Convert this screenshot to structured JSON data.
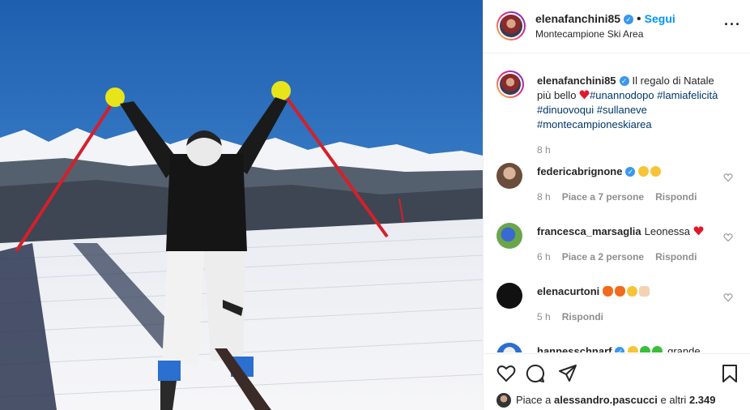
{
  "header": {
    "username": "elenafanchini85",
    "separator": "•",
    "follow_label": "Segui",
    "location": "Montecampione Ski Area",
    "more_icon": "more-icon"
  },
  "caption": {
    "username": "elenafanchini85",
    "text": "Il regalo di Natale più bello",
    "hashtags": [
      "#unannodopo",
      "#lamiafelicità",
      "#dinuovoqui",
      "#sullaneve",
      "#montecampioneskiarea"
    ],
    "time": "8 h"
  },
  "comments": [
    {
      "username": "federicabrignone",
      "emojis": [
        "heart-eyes-emoji",
        "heart-eyes-emoji"
      ],
      "text": "",
      "time": "8 h",
      "likes": "Piace a 7 persone",
      "reply": "Rispondi"
    },
    {
      "username": "francesca_marsaglia",
      "text": "Leonessa",
      "emojis": [
        "red-heart-emoji"
      ],
      "time": "6 h",
      "likes": "Piace a 2 persone",
      "reply": "Rispondi"
    },
    {
      "username": "elenacurtoni",
      "text": "",
      "emojis": [
        "fire-emoji",
        "fire-emoji",
        "kiss-emoji",
        "flexed-biceps-emoji"
      ],
      "time": "5 h",
      "likes": "",
      "reply": "Rispondi"
    },
    {
      "username": "hannesschnarf",
      "text": "grande",
      "emojis": [
        "grin-emoji",
        "green-heart-emoji",
        "green-heart-emoji"
      ],
      "partial": true
    }
  ],
  "footer": {
    "likes_prefix": "Piace a",
    "liked_by": "alessandro.pascucci",
    "likes_suffix": "e altri",
    "likes_count": "2.349"
  },
  "colors": {
    "link": "#00376b",
    "follow": "#0095f6",
    "verified": "#3897f0",
    "muted": "#8e8e8e"
  }
}
